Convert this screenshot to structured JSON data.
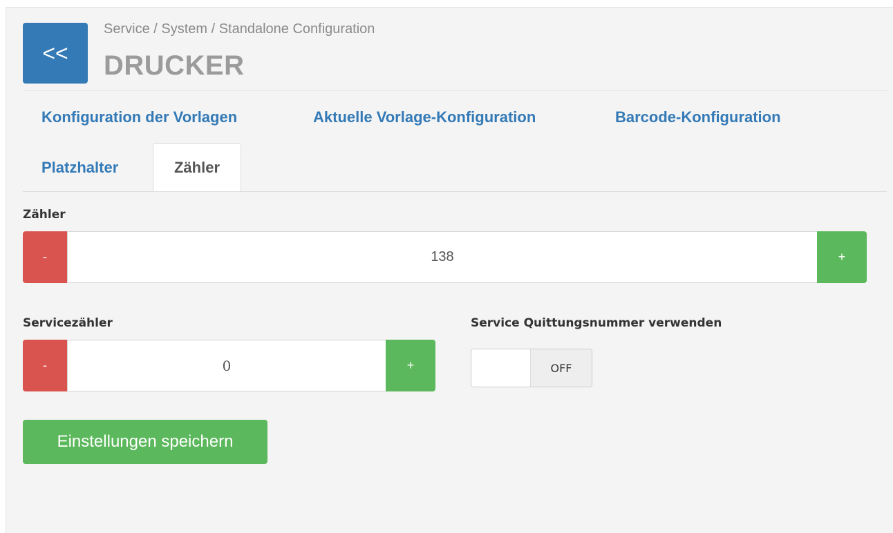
{
  "header": {
    "back_label": "<<",
    "breadcrumb": "Service / System / Standalone Configuration",
    "title": "DRUCKER"
  },
  "tabs": [
    {
      "label": "Konfiguration der Vorlagen",
      "active": false
    },
    {
      "label": "Aktuelle Vorlage-Konfiguration",
      "active": false
    },
    {
      "label": "Barcode-Konfiguration",
      "active": false
    },
    {
      "label": "Platzhalter",
      "active": false
    },
    {
      "label": "Zähler",
      "active": true
    }
  ],
  "counter": {
    "label": "Zähler",
    "value": "138",
    "minus": "-",
    "plus": "+"
  },
  "service_counter": {
    "label": "Servicezähler",
    "value": "0",
    "minus": "-",
    "plus": "+"
  },
  "receipt_toggle": {
    "label": "Service Quittungsnummer verwenden",
    "state": "OFF"
  },
  "save_label": "Einstellungen speichern",
  "colors": {
    "primary": "#337ab7",
    "danger": "#d9534f",
    "success": "#5cb85c"
  }
}
